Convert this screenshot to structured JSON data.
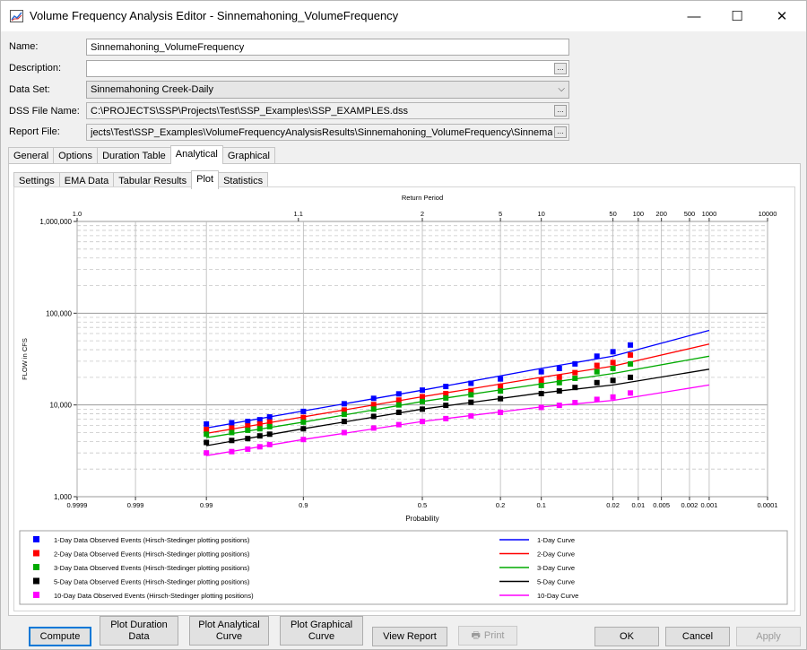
{
  "window": {
    "title": "Volume Frequency Analysis Editor - Sinnemahoning_VolumeFrequency",
    "minimize": "—",
    "maximize": "☐",
    "close": "✕"
  },
  "fields": {
    "name_label": "Name:",
    "name_value": "Sinnemahoning_VolumeFrequency",
    "description_label": "Description:",
    "description_value": "",
    "dataset_label": "Data Set:",
    "dataset_value": "Sinnemahoning Creek-Daily",
    "dss_label": "DSS File Name:",
    "dss_value": "C:\\PROJECTS\\SSP\\Projects\\Test\\SSP_Examples\\SSP_EXAMPLES.dss",
    "report_label": "Report File:",
    "report_value": "jects\\Test\\SSP_Examples\\VolumeFrequencyAnalysisResults\\Sinnemahoning_VolumeFrequency\\Sinnemaho",
    "ellipsis": "..."
  },
  "main_tabs": [
    "General",
    "Options",
    "Duration Table",
    "Analytical",
    "Graphical"
  ],
  "sub_tabs": [
    "Settings",
    "EMA Data",
    "Tabular Results",
    "Plot",
    "Statistics"
  ],
  "colors": {
    "1-Day": "#0000ff",
    "2-Day": "#ff0000",
    "3-Day": "#00aa00",
    "5-Day": "#000000",
    "10-Day": "#ff00ff"
  },
  "chart_data": {
    "type": "scatter",
    "xlabel": "Probability",
    "ylabel": "FLOW in CFS",
    "top_axis_label": "Return Period",
    "y_scale": "log",
    "ylim": [
      1000,
      1000000
    ],
    "y_ticks": [
      "1,000",
      "10,000",
      "100,000",
      "1,000,000"
    ],
    "x_scale": "normal-probability",
    "x_ticks_bottom": [
      "0.9999",
      "0.999",
      "0.99",
      "0.9",
      "0.5",
      "0.2",
      "0.1",
      "0.02",
      "0.01",
      "0.005",
      "0.002",
      "0.001",
      "0.0001"
    ],
    "x_ticks_top": [
      "1.0",
      "1.1",
      "2",
      "5",
      "10",
      "50",
      "100",
      "200",
      "500",
      "1000",
      "10000"
    ],
    "series": [
      {
        "name": "1-Day Data Observed Events (Hirsch-Stedinger plotting positions)",
        "kind": "points",
        "color_key": "1-Day",
        "x": [
          0.99,
          0.98,
          0.97,
          0.96,
          0.95,
          0.9,
          0.8,
          0.7,
          0.6,
          0.5,
          0.4,
          0.3,
          0.2,
          0.1,
          0.07,
          0.05,
          0.03,
          0.02,
          0.0125
        ],
        "y": [
          6200,
          6400,
          6600,
          6900,
          7400,
          8500,
          10300,
          11800,
          13200,
          14500,
          15900,
          17200,
          19200,
          23000,
          25000,
          28000,
          34000,
          38000,
          45000
        ]
      },
      {
        "name": "2-Day Data Observed Events (Hirsch-Stedinger plotting positions)",
        "kind": "points",
        "color_key": "2-Day",
        "x": [
          0.99,
          0.98,
          0.97,
          0.96,
          0.95,
          0.9,
          0.8,
          0.7,
          0.6,
          0.5,
          0.4,
          0.3,
          0.2,
          0.1,
          0.07,
          0.05,
          0.03,
          0.02,
          0.0125
        ],
        "y": [
          5400,
          5600,
          5900,
          6200,
          6500,
          7300,
          8800,
          10100,
          11300,
          12300,
          13300,
          14300,
          16000,
          18500,
          20000,
          22500,
          27000,
          29000,
          35000
        ]
      },
      {
        "name": "3-Day Data Observed Events (Hirsch-Stedinger plotting positions)",
        "kind": "points",
        "color_key": "3-Day",
        "x": [
          0.99,
          0.98,
          0.97,
          0.96,
          0.95,
          0.9,
          0.8,
          0.7,
          0.6,
          0.5,
          0.4,
          0.3,
          0.2,
          0.1,
          0.07,
          0.05,
          0.03,
          0.02,
          0.0125
        ],
        "y": [
          4800,
          5000,
          5300,
          5500,
          5800,
          6500,
          7900,
          9000,
          10000,
          10900,
          11900,
          12900,
          14200,
          16300,
          17500,
          19500,
          23000,
          25000,
          28000
        ]
      },
      {
        "name": "5-Day Data Observed Events (Hirsch-Stedinger plotting positions)",
        "kind": "points",
        "color_key": "5-Day",
        "x": [
          0.99,
          0.98,
          0.97,
          0.96,
          0.95,
          0.9,
          0.8,
          0.7,
          0.6,
          0.5,
          0.4,
          0.3,
          0.2,
          0.1,
          0.07,
          0.05,
          0.03,
          0.02,
          0.0125
        ],
        "y": [
          3900,
          4100,
          4300,
          4600,
          4800,
          5500,
          6600,
          7500,
          8300,
          9000,
          9900,
          10700,
          11700,
          13300,
          14200,
          15500,
          17500,
          18500,
          20000
        ]
      },
      {
        "name": "10-Day Data Observed Events (Hirsch-Stedinger plotting positions)",
        "kind": "points",
        "color_key": "10-Day",
        "x": [
          0.99,
          0.98,
          0.97,
          0.96,
          0.95,
          0.9,
          0.8,
          0.7,
          0.6,
          0.5,
          0.4,
          0.3,
          0.2,
          0.1,
          0.07,
          0.05,
          0.03,
          0.02,
          0.0125
        ],
        "y": [
          3000,
          3100,
          3300,
          3500,
          3700,
          4200,
          5000,
          5600,
          6100,
          6600,
          7100,
          7600,
          8300,
          9400,
          9900,
          10600,
          11500,
          12200,
          13500
        ]
      },
      {
        "name": "1-Day Curve",
        "kind": "line",
        "color_key": "1-Day",
        "x": [
          0.99,
          0.9,
          0.5,
          0.1,
          0.02,
          0.001
        ],
        "y": [
          5600,
          8600,
          14500,
          25000,
          34000,
          65000
        ]
      },
      {
        "name": "2-Day Curve",
        "kind": "line",
        "color_key": "2-Day",
        "x": [
          0.99,
          0.9,
          0.5,
          0.1,
          0.02,
          0.001
        ],
        "y": [
          4900,
          7400,
          12300,
          20000,
          26500,
          46000
        ]
      },
      {
        "name": "3-Day Curve",
        "kind": "line",
        "color_key": "3-Day",
        "x": [
          0.99,
          0.9,
          0.5,
          0.1,
          0.02,
          0.001
        ],
        "y": [
          4400,
          6500,
          10900,
          17000,
          22000,
          34000
        ]
      },
      {
        "name": "5-Day Curve",
        "kind": "line",
        "color_key": "5-Day",
        "x": [
          0.99,
          0.9,
          0.5,
          0.1,
          0.02,
          0.001
        ],
        "y": [
          3600,
          5500,
          9000,
          13500,
          16500,
          24500
        ]
      },
      {
        "name": "10-Day Curve",
        "kind": "line",
        "color_key": "10-Day",
        "x": [
          0.99,
          0.9,
          0.5,
          0.1,
          0.02,
          0.001
        ],
        "y": [
          2800,
          4200,
          6600,
          9500,
          11200,
          16500
        ]
      }
    ],
    "legend_position": "bottom"
  },
  "buttons": {
    "compute": "Compute",
    "plot_duration": "Plot Duration\nData",
    "plot_analytical": "Plot Analytical\nCurve",
    "plot_graphical": "Plot Graphical\nCurve",
    "view_report": "View Report",
    "print": "Print",
    "ok": "OK",
    "cancel": "Cancel",
    "apply": "Apply"
  }
}
